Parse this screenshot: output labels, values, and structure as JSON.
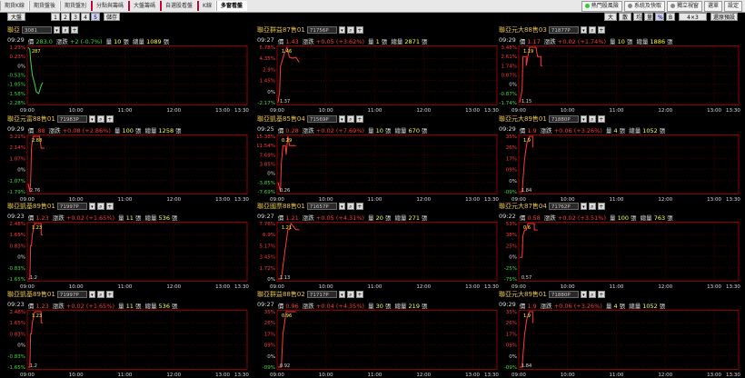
{
  "topbar": {
    "tabs": [
      "期貨K線",
      "期貨盤後",
      "期貨盤別",
      "分點與籌碼",
      "大盤籌碼",
      "自選股看盤",
      "K線",
      "多窗看盤"
    ],
    "active_tab": 7,
    "right_buttons": [
      "熱門股風險",
      "系統及快取",
      "獨立視窗",
      "選單",
      "設定"
    ]
  },
  "toolbar": {
    "left_btn": "大盤",
    "pages": [
      "1",
      "2",
      "3",
      "4",
      "5"
    ],
    "active_page": 4,
    "mid_btn": "儲存",
    "right_btns": [
      "大戶",
      "散戶",
      "均",
      "量",
      "%",
      "B",
      "4×3",
      "還原預設"
    ]
  },
  "labels": {
    "price": "價",
    "change": "漲跌",
    "vol": "量",
    "unit": "張",
    "total": "總量"
  },
  "time_ticks": [
    "09:00",
    "10:00",
    "11:00",
    "12:00",
    "13:00",
    "13:30"
  ],
  "colors": {
    "up": "#ff3a3a",
    "down": "#3cdc3c",
    "name": "#e8c54a",
    "grid": "#8b0000"
  },
  "panels": [
    {
      "name": "聯亞",
      "code": "3081",
      "time": "09:29",
      "price": "283.0",
      "chg": "+2 (-0.7%)",
      "vol": "10",
      "total": "1089",
      "dir": "dn",
      "yticks": [
        "1.23%",
        "0.23%",
        "0%",
        "-0.53%",
        "-1.05%",
        "-1.58%",
        "-2.28%"
      ],
      "hi_label": "287",
      "lo_label": "",
      "series": [
        [
          0,
          1.23
        ],
        [
          2,
          1.1
        ],
        [
          3,
          0.4
        ],
        [
          5,
          -0.5
        ],
        [
          8,
          -1.1
        ],
        [
          10,
          -1.6
        ],
        [
          13,
          -1.7
        ],
        [
          16,
          -1.2
        ],
        [
          18,
          -1.0
        ]
      ],
      "series_color": "down"
    },
    {
      "name": "聯亞群益87售01",
      "code": "71756P",
      "time": "09:27",
      "price": "1.43",
      "chg": "+0.05 (+3.62%)",
      "vol": "1",
      "total": "2871",
      "dir": "up",
      "yticks": [
        "5.78%",
        "4.35%",
        "2.9%",
        "1.45%",
        "0%",
        "-2.17%"
      ],
      "hi_label": "1.46",
      "lo_label": "1.37",
      "series": [
        [
          0,
          -2.17
        ],
        [
          2,
          -0.5
        ],
        [
          3,
          3.0
        ],
        [
          5,
          3.8
        ],
        [
          8,
          5.0
        ],
        [
          11,
          5.78
        ],
        [
          14,
          4.35
        ],
        [
          18,
          4.2
        ],
        [
          22,
          4.35
        ],
        [
          26,
          3.6
        ]
      ],
      "series_color": "up"
    },
    {
      "name": "聯亞元大88售03",
      "code": "71877P",
      "time": "09:29",
      "price": "1.17",
      "chg": "+0.02 (+1.74%)",
      "vol": "10",
      "total": "1886",
      "dir": "up",
      "yticks": [
        "3.48%",
        "2.61%",
        "1.74%",
        "0.87%",
        "0%",
        "-0.87%",
        "-1.74%"
      ],
      "hi_label": "1.19",
      "lo_label": "1.15",
      "series": [
        [
          0,
          -1.74
        ],
        [
          3,
          -0.5
        ],
        [
          4,
          2.61
        ],
        [
          8,
          2.61
        ],
        [
          8,
          1.74
        ],
        [
          12,
          3.48
        ],
        [
          20,
          3.48
        ],
        [
          22,
          2.61
        ],
        [
          26,
          2.61
        ],
        [
          26,
          1.74
        ],
        [
          28,
          1.74
        ]
      ],
      "series_color": "up"
    },
    {
      "name": "聯亞元富88售01",
      "code": "71983P",
      "time": "09:29",
      "price": ".88",
      "chg": "+0.08 (+2.86%)",
      "vol": "100",
      "total": "1258",
      "dir": "up",
      "yticks": [
        "3.21%",
        "2.14%",
        "1.07%",
        "0%",
        "-1.07%",
        "-1.79%"
      ],
      "hi_label": "2.88",
      "lo_label": "2.76",
      "series": [
        [
          0,
          -1.07
        ],
        [
          2,
          -1.79
        ],
        [
          3,
          -1.0
        ],
        [
          4,
          2.14
        ],
        [
          6,
          3.21
        ],
        [
          14,
          3.21
        ],
        [
          16,
          2.14
        ],
        [
          20,
          2.14
        ]
      ],
      "series_color": "up"
    },
    {
      "name": "聯亞凱基85售04",
      "code": "71569P",
      "time": "09:25",
      "price": "0.28",
      "chg": "+0.02 (+7.69%)",
      "vol": "10",
      "total": "670",
      "dir": "up",
      "yticks": [
        "15.38%",
        "11.54%",
        "7.69%",
        "3.85%",
        "0%",
        "-3.85%",
        "-7.69%"
      ],
      "hi_label": "0.29",
      "lo_label": "0.26",
      "series": [
        [
          0,
          -3.85
        ],
        [
          3,
          -7.69
        ],
        [
          4,
          3.85
        ],
        [
          6,
          11.54
        ],
        [
          9,
          11.54
        ],
        [
          10,
          7.69
        ],
        [
          12,
          15.38
        ],
        [
          14,
          11.54
        ],
        [
          22,
          11.54
        ]
      ],
      "series_color": "up"
    },
    {
      "name": "聯亞元大89售01",
      "code": "71880P",
      "time": "09:29",
      "price": "1.9",
      "chg": "+0.06 (+3.26%)",
      "vol": "4",
      "total": "1052",
      "dir": "up",
      "yticks": [
        "35%",
        "26%",
        "17%",
        "09%",
        "0%",
        "-09%"
      ],
      "hi_label": "1.9",
      "lo_label": "1.84",
      "series": [
        [
          0,
          -0.09
        ],
        [
          3,
          -0.09
        ],
        [
          4,
          0.0
        ],
        [
          6,
          0.17
        ],
        [
          8,
          0.26
        ],
        [
          9,
          0.3
        ],
        [
          12,
          0.35
        ],
        [
          16,
          0.35
        ],
        [
          16,
          0.26
        ]
      ],
      "series_color": "up"
    },
    {
      "name": "聯亞凱基89售01",
      "code": "71997P",
      "time": "09:23",
      "price": "1.23",
      "chg": "+0.02 (+1.65%)",
      "vol": "11",
      "total": "536",
      "dir": "up",
      "yticks": [
        "2.48%",
        "1.65%",
        "0.83%",
        "0%",
        "-0.83%",
        "-1.65%"
      ],
      "hi_label": "1.23",
      "lo_label": "1.2",
      "series": [
        [
          0,
          -1.65
        ],
        [
          2,
          -1.65
        ],
        [
          3,
          0.83
        ],
        [
          4,
          0.83
        ],
        [
          5,
          1.65
        ],
        [
          8,
          2.48
        ],
        [
          16,
          2.48
        ],
        [
          16,
          1.65
        ],
        [
          18,
          1.65
        ]
      ],
      "series_color": "up"
    },
    {
      "name": "聯亞國票88售01",
      "code": "71657P",
      "time": "09:27",
      "price": "1.21",
      "chg": "+0.05 (+4.31%)",
      "vol": "20",
      "total": "271",
      "dir": "up",
      "yticks": [
        "7.76%",
        "6.9%",
        "5.17%",
        "3.45%",
        "1.72%",
        "0%"
      ],
      "hi_label": "1.21",
      "lo_label": "1.13",
      "series": [
        [
          0,
          0
        ],
        [
          4,
          0
        ],
        [
          6,
          1.72
        ],
        [
          8,
          3.45
        ],
        [
          10,
          5.17
        ],
        [
          12,
          6.9
        ],
        [
          14,
          6.9
        ],
        [
          16,
          7.76
        ],
        [
          22,
          6.9
        ],
        [
          26,
          6.9
        ]
      ],
      "series_color": "up"
    },
    {
      "name": "聯亞元大87售04",
      "code": "71762P",
      "time": "09:22",
      "price": "0.58",
      "chg": "+0.02 (+3.51%)",
      "vol": "100",
      "total": "763",
      "dir": "up",
      "yticks": [
        "53%",
        "38%",
        "25%",
        "0%",
        "-25%",
        "-75%"
      ],
      "hi_label": "0.6",
      "lo_label": "0.57",
      "series": [
        [
          0,
          -0.25
        ],
        [
          3,
          -0.25
        ],
        [
          4,
          0.25
        ],
        [
          6,
          0.38
        ],
        [
          8,
          0.38
        ],
        [
          10,
          0.53
        ],
        [
          18,
          0.53
        ],
        [
          18,
          0.38
        ],
        [
          22,
          0.38
        ]
      ],
      "series_color": "up"
    },
    {
      "name": "聯亞凱基89售01",
      "code": "71997P",
      "time": "09:23",
      "price": "1.23",
      "chg": "+0.02 (+1.65%)",
      "vol": "11",
      "total": "536",
      "dir": "up",
      "yticks": [
        "2.48%",
        "1.65%",
        "0.83%",
        "0%",
        "-0.83%",
        "-1.65%"
      ],
      "hi_label": "1.23",
      "lo_label": "1.2",
      "series": [
        [
          0,
          -1.65
        ],
        [
          2,
          -1.65
        ],
        [
          3,
          0.83
        ],
        [
          4,
          0.83
        ],
        [
          5,
          1.65
        ],
        [
          8,
          2.48
        ],
        [
          16,
          2.48
        ],
        [
          16,
          1.65
        ],
        [
          18,
          1.65
        ]
      ],
      "series_color": "up"
    },
    {
      "name": "聯亞群益88售02",
      "code": "71717P",
      "time": "09:27",
      "price": "0.96",
      "chg": "+0.04 (+4.35%)",
      "vol": "30",
      "total": "219",
      "dir": "up",
      "yticks": [
        "35%",
        "26%",
        "17%",
        "09%",
        "0%",
        "-09%"
      ],
      "hi_label": "0.96",
      "lo_label": "0.92",
      "series": [
        [
          0,
          -0.09
        ],
        [
          4,
          -0.09
        ],
        [
          6,
          0.17
        ],
        [
          8,
          0.26
        ],
        [
          10,
          0.35
        ],
        [
          16,
          0.35
        ],
        [
          22,
          0.35
        ]
      ],
      "series_color": "up"
    },
    {
      "name": "聯亞元大89售01",
      "code": "71880P",
      "time": "09:29",
      "price": "1.9",
      "chg": "+0.06 (+3.26%)",
      "vol": "4",
      "total": "1052",
      "dir": "up",
      "yticks": [
        "35%",
        "26%",
        "17%",
        "09%",
        "0%",
        "-09%"
      ],
      "hi_label": "1.9",
      "lo_label": "1.84",
      "series": [
        [
          0,
          -0.09
        ],
        [
          3,
          -0.09
        ],
        [
          4,
          0.0
        ],
        [
          6,
          0.17
        ],
        [
          8,
          0.26
        ],
        [
          9,
          0.3
        ],
        [
          12,
          0.35
        ],
        [
          16,
          0.35
        ],
        [
          16,
          0.26
        ]
      ],
      "series_color": "up"
    }
  ]
}
